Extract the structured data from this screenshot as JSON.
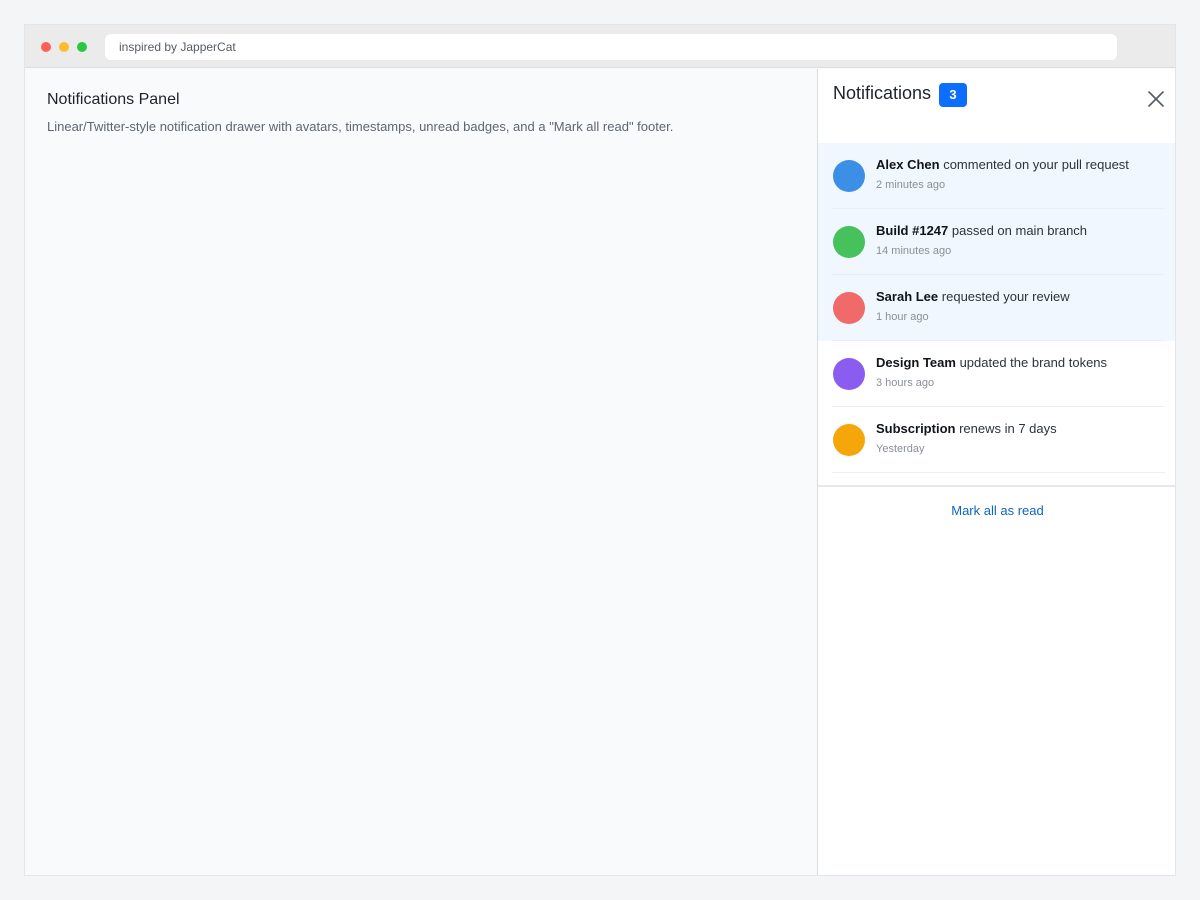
{
  "browser": {
    "url_text": "inspired by JapperCat"
  },
  "page": {
    "title": "Notifications Panel",
    "description": "Linear/Twitter-style notification drawer with avatars, timestamps, unread badges, and a \"Mark all read\" footer."
  },
  "drawer": {
    "title": "Notifications",
    "unread_count": "3",
    "close_icon": "close-icon",
    "footer_action": "Mark all as read"
  },
  "notifications": [
    {
      "actor": "Alex Chen",
      "action": "commented on your pull request",
      "time": "2 minutes ago",
      "unread": true,
      "avatar_color": "#3b8fe6"
    },
    {
      "actor": "Build #1247",
      "action": "passed on main branch",
      "time": "14 minutes ago",
      "unread": true,
      "avatar_color": "#46c15b"
    },
    {
      "actor": "Sarah Lee",
      "action": "requested your review",
      "time": "1 hour ago",
      "unread": true,
      "avatar_color": "#f06a6a"
    },
    {
      "actor": "Design Team",
      "action": "updated the brand tokens",
      "time": "3 hours ago",
      "unread": false,
      "avatar_color": "#8b5cf0"
    },
    {
      "actor": "Subscription",
      "action": "renews in 7 days",
      "time": "Yesterday",
      "unread": false,
      "avatar_color": "#f5a70a"
    }
  ],
  "colors": {
    "accent": "#0d6efd",
    "unread_bg": "#f0f7fe",
    "link": "#0a66c2"
  }
}
